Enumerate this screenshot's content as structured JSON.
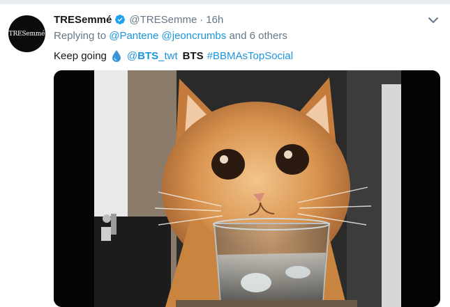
{
  "tweet": {
    "avatar_text": "TRESemmé",
    "display_name": "TRESemmé",
    "handle": "@TRESemme",
    "separator": "·",
    "time": "16h",
    "verified": true,
    "reply_prefix": "Replying to",
    "reply_mentions": [
      "@Pantene",
      "@jeoncrumbs"
    ],
    "reply_suffix": "and 6 others",
    "text_start": "Keep going",
    "emoji": "droplet-icon",
    "mention_at": "@",
    "mention_bold": "BTS",
    "mention_rest": "_twt",
    "bold_word": "BTS",
    "hashtag": "#BBMAsTopSocial",
    "media": {
      "type": "gif",
      "subject": "orange cat drinking from a glass of water"
    }
  },
  "colors": {
    "link": "#1b95e0",
    "secondary_text": "#657786",
    "primary_text": "#14171a",
    "verified_badge": "#1da1f2"
  }
}
